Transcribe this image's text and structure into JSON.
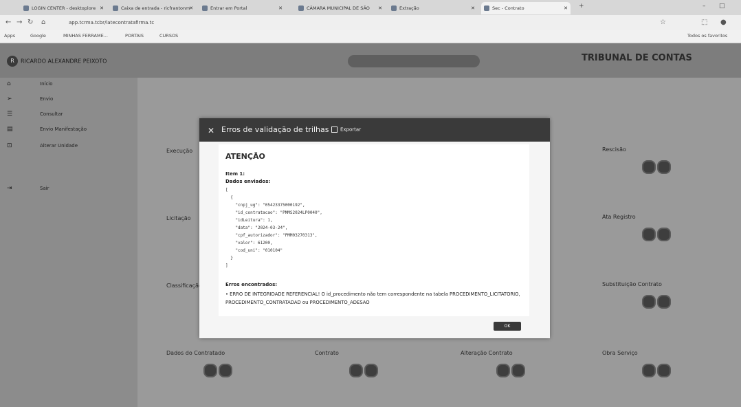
{
  "browser": {
    "tabs": [
      {
        "label": "LOGIN CENTER - desktoplore"
      },
      {
        "label": "Caixa de entrada - ricfrantonm"
      },
      {
        "label": "Entrar em Portal"
      },
      {
        "label": "CÂMARA MUNICIPAL DE SÃO"
      },
      {
        "label": "Extração"
      },
      {
        "label": "Sec - Contrato",
        "active": true
      }
    ],
    "url": "app.tcrma.tcbr/latecontratafirma.tc",
    "bookmarks": [
      "Apps",
      "Google",
      "MINHAS FERRAME...",
      "PORTAIS",
      "CURSOS"
    ],
    "bookmarks_right": "Todos os favoritos"
  },
  "page": {
    "user_name": "RICARDO ALEXANDRE PEIXOTO",
    "logo": "TRIBUNAL DE CONTAS",
    "sidebar": [
      {
        "icon": "home",
        "label": "Início"
      },
      {
        "icon": "send",
        "label": "Envio"
      },
      {
        "icon": "list",
        "label": "Consultar"
      },
      {
        "icon": "doc",
        "label": "Envio Manifestação"
      },
      {
        "icon": "lock",
        "label": "Alterar Unidade"
      },
      {
        "icon": "exit",
        "label": "Sair"
      }
    ],
    "cards": {
      "left1": "Execução",
      "left2": "Licitação",
      "left3": "Classificação",
      "right1": "Rescisão",
      "right2": "Ata Registro",
      "right3": "Substituição Contrato",
      "bottom1": "Dados do Contratado",
      "bottom2": "Contrato",
      "bottom3": "Alteração Contrato",
      "bottom4": "Obra Serviço"
    }
  },
  "modal": {
    "title": "Erros de validação de trilhas",
    "export_label": "Exportar",
    "attention": "ATENÇÃO",
    "item_label": "Item 1:",
    "sent_label": "Dados enviados:",
    "json_lines": [
      "[",
      "  {",
      "    \"cnpj_ug\": \"05423375000192\",",
      "    \"id_contratacao\": \"PMMS2024LP0040\",",
      "    \"idLeitura\": 1,",
      "    \"data\": \"2024-03-24\",",
      "    \"cpf_autorizador\": \"PMM03270313\",",
      "    \"valor\": 61200,",
      "    \"cod_uni\": \"010104\"",
      "  }",
      "]"
    ],
    "errors_label": "Erros encontrados:",
    "error_text": "• ERRO DE INTEGRIDADE REFERENCIAL! O id_procedimento não tem correspondente na tabela PROCEDIMENTO_LICITATORIO, PROCEDIMENTO_CONTRATADAD ou PROCEDIMENTO_ADESAO",
    "ok_label": "OK"
  }
}
